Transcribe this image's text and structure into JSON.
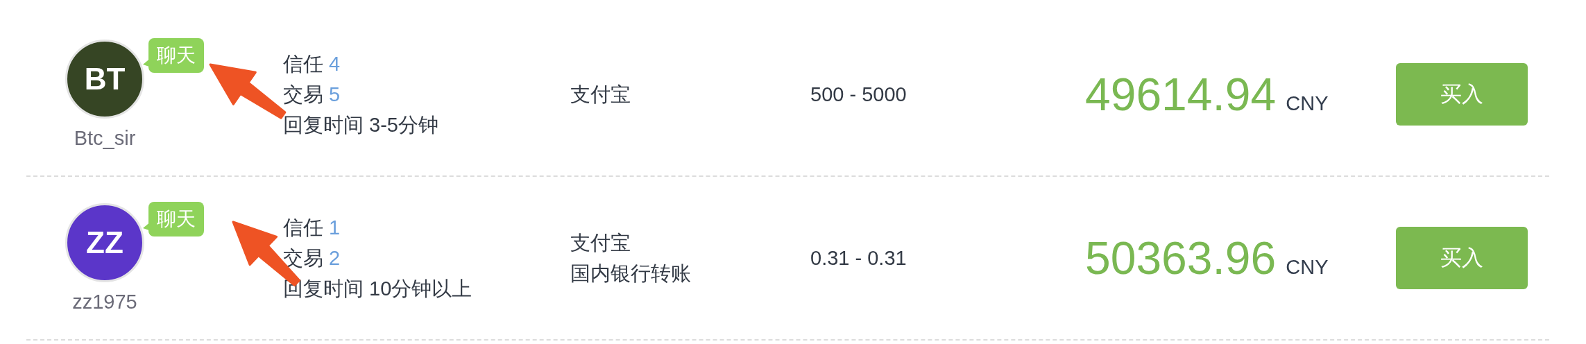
{
  "offers": [
    {
      "avatar": {
        "initials": "BT",
        "color": "#364524"
      },
      "chat_badge": "聊天",
      "username": "Btc_sir",
      "trust_label": "信任",
      "trust": "4",
      "trades_label": "交易",
      "trades": "5",
      "response_time": "回复时间 3-5分钟",
      "payment_methods": [
        "支付宝"
      ],
      "limits": "500 - 5000",
      "price": "49614.94",
      "currency": "CNY",
      "buy_button": "买入",
      "annotated": true
    },
    {
      "avatar": {
        "initials": "ZZ",
        "color": "#5b36c9"
      },
      "chat_badge": "聊天",
      "username": "zz1975",
      "trust_label": "信任",
      "trust": "1",
      "trades_label": "交易",
      "trades": "2",
      "response_time": "回复时间 10分钟以上",
      "payment_methods": [
        "支付宝",
        "国内银行转账"
      ],
      "limits": "0.31 - 0.31",
      "price": "50363.96",
      "currency": "CNY",
      "buy_button": "买入",
      "annotated": true
    }
  ]
}
